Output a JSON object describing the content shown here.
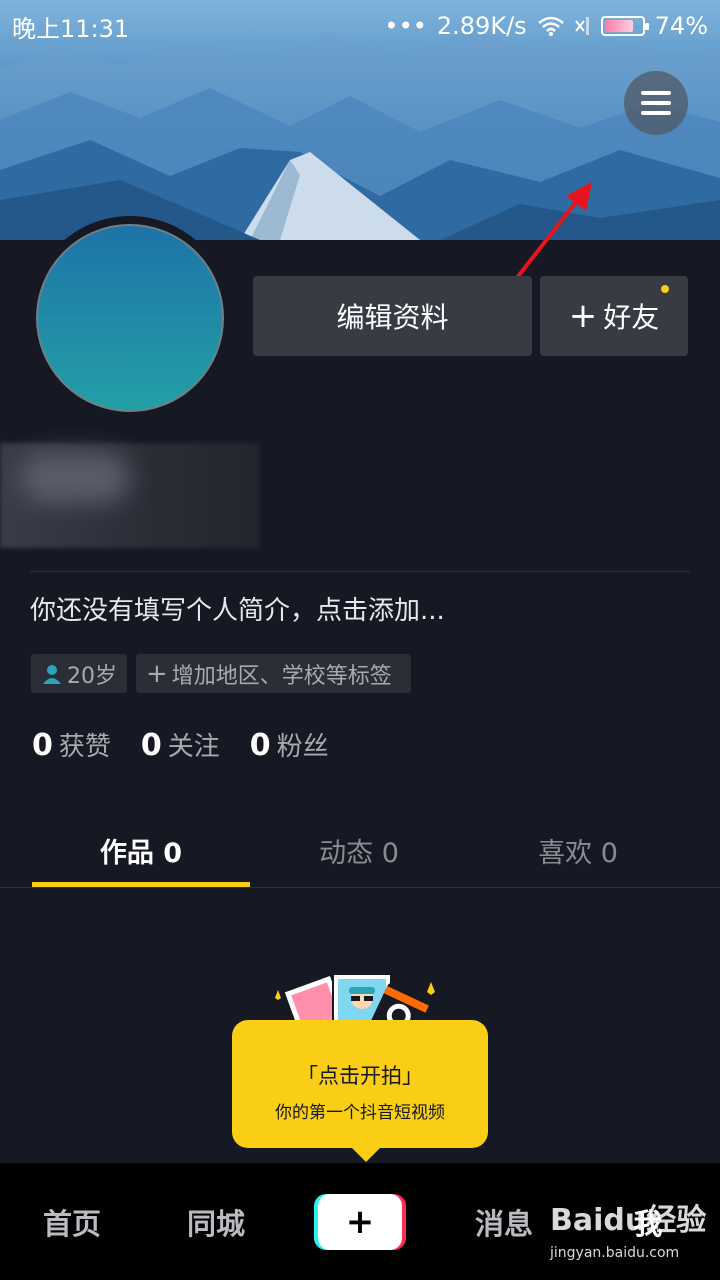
{
  "status_bar": {
    "time": "晚上11:31",
    "more": "•••",
    "speed": "2.89K/s",
    "battery": "74%"
  },
  "profile": {
    "edit_label": "编辑资料",
    "friend_plus": "+",
    "friend_label": "好友",
    "bio": "你还没有填写个人简介，点击添加...",
    "tags": [
      {
        "icon": "person-icon",
        "label": "20岁"
      },
      {
        "icon": "plus-icon",
        "label": "增加地区、学校等标签"
      }
    ],
    "stats": [
      {
        "value": "0",
        "label": "获赞"
      },
      {
        "value": "0",
        "label": "关注"
      },
      {
        "value": "0",
        "label": "粉丝"
      }
    ]
  },
  "tabs": [
    {
      "label": "作品 0",
      "active": true
    },
    {
      "label": "动态 0",
      "active": false
    },
    {
      "label": "喜欢 0",
      "active": false
    }
  ],
  "promo": {
    "title": "「点击开拍」",
    "subtitle": "你的第一个抖音短视频"
  },
  "bottom_nav": {
    "home": "首页",
    "nearby": "同城",
    "create": "+",
    "messages": "消息",
    "me": "我"
  },
  "watermark": {
    "logo": "Baidu经验",
    "url": "jingyan.baidu.com"
  },
  "colors": {
    "background": "#161823",
    "accent": "#face15",
    "button": "#393b44",
    "annotation_arrow": "#e8141b"
  }
}
